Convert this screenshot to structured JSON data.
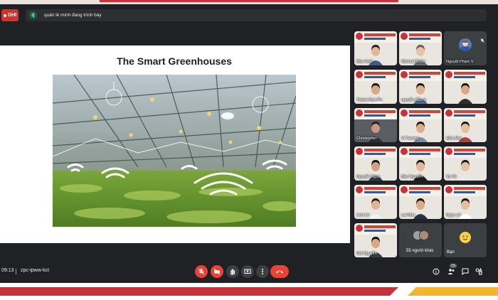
{
  "recording": {
    "label": "GHI"
  },
  "presenter": {
    "initial": "q",
    "text": "quản lê minh đang trình bày"
  },
  "slide": {
    "title": "The Smart Greenhouses"
  },
  "participants": [
    {
      "name": "Bảo Hoài",
      "muted": false,
      "col": 0,
      "row": 0,
      "skin": "#e0b899",
      "hair": "#2b1d16",
      "shirt": "#3a5b8c"
    },
    {
      "name": "Michael Robe",
      "muted": false,
      "col": 1,
      "row": 0,
      "skin": "#e8c3a4",
      "hair": "#6b5a4a",
      "shirt": "#6a6f7a"
    },
    {
      "name": "Nguyệt Phạm V",
      "muted": true,
      "col": 2,
      "row": 0,
      "avatar": true
    },
    {
      "name": "Thành Nguyễn",
      "muted": false,
      "col": 0,
      "row": 1,
      "skin": "#d8a987",
      "hair": "#1b1410",
      "shirt": "#ffffff"
    },
    {
      "name": "nguyễn đắu ni",
      "muted": true,
      "col": 1,
      "row": 1,
      "skin": "#e1b291",
      "hair": "#1a1310",
      "shirt": "#4b6fa8"
    },
    {
      "name": "",
      "muted": false,
      "col": 2,
      "row": 1,
      "skin": "#d9aa88",
      "hair": "#1a1310",
      "shirt": "#2f2f2f"
    },
    {
      "name": "Christopher",
      "muted": true,
      "col": 0,
      "row": 2,
      "skin": "#c89a7d",
      "hair": "#2a201a",
      "shirt": "#2c3036",
      "darkbg": true
    },
    {
      "name": "Vi Trương",
      "muted": false,
      "col": 1,
      "row": 2,
      "skin": "#dcae8b",
      "hair": "#1e1611",
      "shirt": "#7c8ea8"
    },
    {
      "name": "Kiều Mai",
      "muted": false,
      "col": 2,
      "row": 2,
      "skin": "#e6bd9e",
      "hair": "#1e1611",
      "shirt": "#b93b3b"
    },
    {
      "name": "Nguyễn Ngọc",
      "muted": false,
      "col": 0,
      "row": 3,
      "skin": "#d2a181",
      "hair": "#140f0c",
      "shirt": "#2d3a57"
    },
    {
      "name": "Bảo Nguyễn",
      "muted": false,
      "col": 1,
      "row": 3,
      "skin": "#e3b797",
      "hair": "#140f0c",
      "shirt": "#1e1e1e"
    },
    {
      "name": "Vy Võ",
      "muted": true,
      "col": 2,
      "row": 3,
      "skin": "#e7c0a3",
      "hair": "#231912",
      "shirt": "#e9e9e9"
    },
    {
      "name": "Linh Lê",
      "muted": false,
      "col": 0,
      "row": 4,
      "skin": "#e2b393",
      "hair": "#2a1d14",
      "shirt": "#f1f1f1"
    },
    {
      "name": "Lai Như",
      "muted": false,
      "col": 1,
      "row": 4,
      "skin": "#dcab88",
      "hair": "#181210",
      "shirt": "#26324a"
    },
    {
      "name": "Ngọc Lê",
      "muted": false,
      "col": 2,
      "row": 4,
      "skin": "#e5bd9f",
      "hair": "#1c140f",
      "shirt": "#ffffff"
    },
    {
      "name": "Hải Nguyễn",
      "muted": false,
      "col": 0,
      "row": 5,
      "skin": "#d9a887",
      "hair": "#161010",
      "shirt": "#3a3f48"
    }
  ],
  "others": {
    "label": "55 người khác"
  },
  "self": {
    "label": "Bạn"
  },
  "meeting": {
    "time": "09:13",
    "code": "zpc-ipww-kct",
    "participant_count": "73"
  },
  "colors": {
    "accent_red": "#ea4335",
    "bar_bg": "#202124",
    "tile_bg": "#3c4043"
  }
}
